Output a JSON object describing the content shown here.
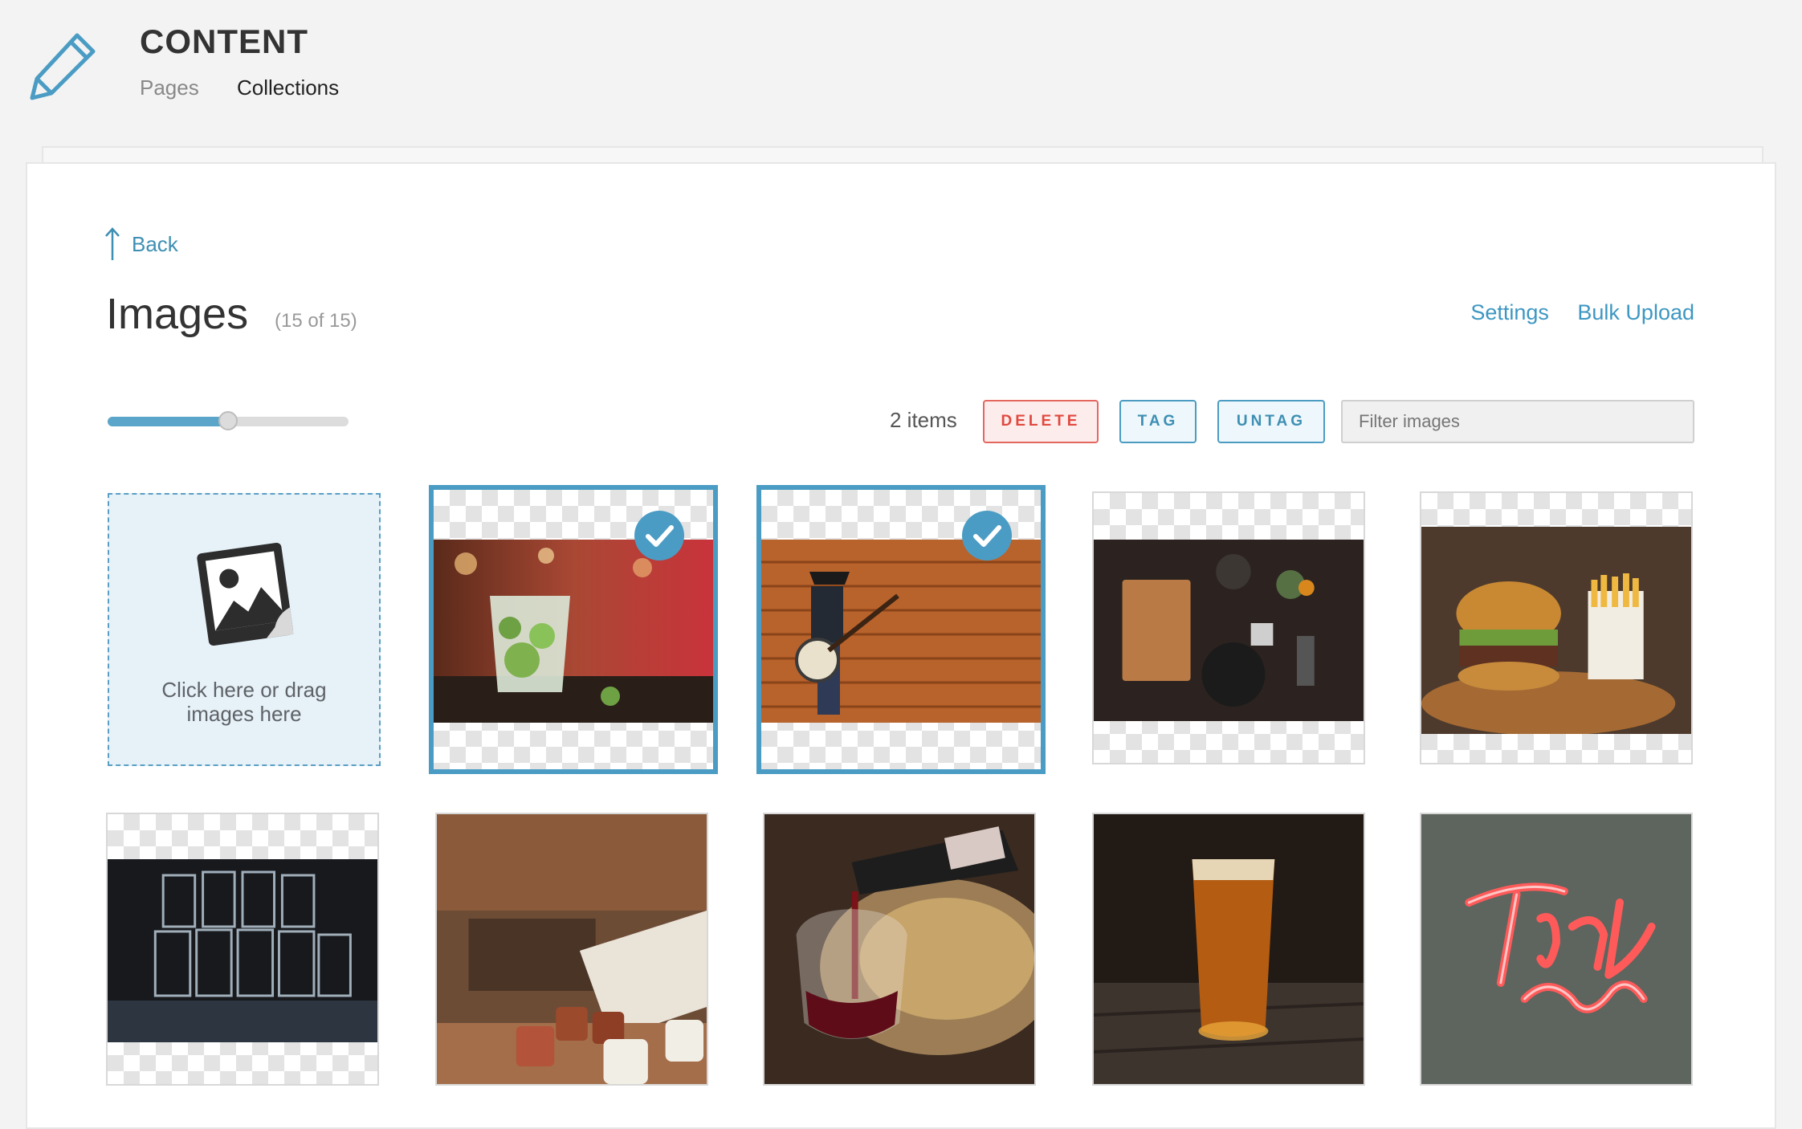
{
  "header": {
    "title": "CONTENT",
    "nav": {
      "pages": "Pages",
      "collections": "Collections"
    }
  },
  "back_label": "Back",
  "page_title": "Images",
  "count": "(15 of 15)",
  "links": {
    "settings": "Settings",
    "bulk_upload": "Bulk Upload"
  },
  "toolbar": {
    "items_count": "2 items",
    "delete_label": "DELETE",
    "tag_label": "TAG",
    "untag_label": "UNTAG",
    "filter_placeholder": "Filter images",
    "slider_value": 0.5
  },
  "upload": {
    "text": "Click here or drag images here"
  },
  "colors": {
    "accent": "#4b9cc4",
    "danger": "#e0493f"
  },
  "images": [
    {
      "name": "mojito cocktail on bar",
      "selected": true
    },
    {
      "name": "banjo player against wooden wall",
      "selected": true
    },
    {
      "name": "cutting board and cookware on wooden table",
      "selected": false
    },
    {
      "name": "burger and fries on wooden board",
      "selected": false
    },
    {
      "name": "stacked glasses on bar",
      "selected": false
    },
    {
      "name": "enamel cups on wooden table",
      "selected": false
    },
    {
      "name": "red wine being poured",
      "selected": false
    },
    {
      "name": "pint of beer on table",
      "selected": false
    },
    {
      "name": "neon thank you sign",
      "selected": false
    }
  ]
}
